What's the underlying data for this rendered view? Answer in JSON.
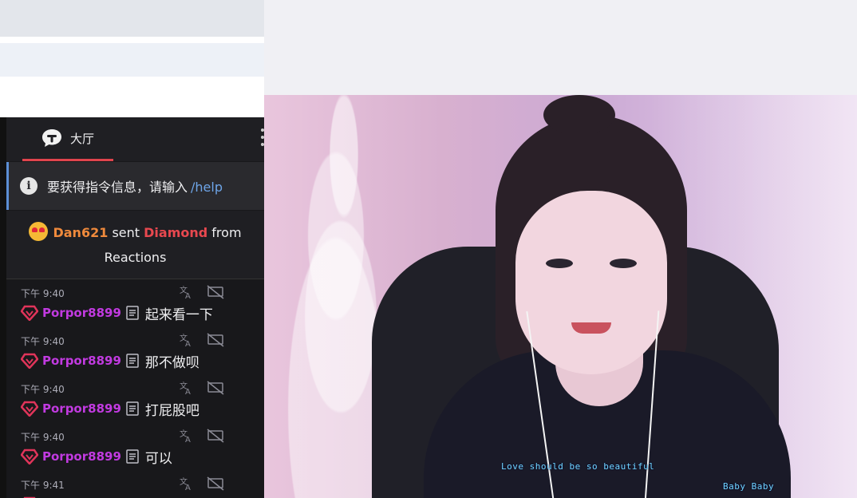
{
  "chat": {
    "tab_label": "大厅",
    "help_notice": {
      "text": "要获得指令信息，请输入",
      "command": "/help"
    },
    "gift_notice": {
      "user": "Dan621",
      "verb": "sent",
      "item": "Diamond",
      "from_word": "from",
      "source": "Reactions"
    },
    "messages": [
      {
        "time": "下午 9:40",
        "user": "Porpor8899",
        "text": "起来看一下"
      },
      {
        "time": "下午 9:40",
        "user": "Porpor8899",
        "text": "那不做呗"
      },
      {
        "time": "下午 9:40",
        "user": "Porpor8899",
        "text": "打屁股吧"
      },
      {
        "time": "下午 9:40",
        "user": "Porpor8899",
        "text": "可以"
      },
      {
        "time": "下午 9:41",
        "user": "",
        "text": ""
      }
    ]
  },
  "video": {
    "caption_1": "Love should be so beautiful",
    "caption_2": "Baby Baby"
  },
  "colors": {
    "chat_bg": "#18181b",
    "tab_underline": "#e0444d",
    "help_command": "#6ea5e8",
    "gift_user": "#f08a3c",
    "gift_item": "#e8484f",
    "username": "#c13ae0",
    "caption": "#6fd6ff"
  },
  "icons": {
    "tab": "chat-bubble-icon",
    "help": "info-icon",
    "gift": "heart-eyes-emoji-icon",
    "translate": "translate-icon",
    "block": "hide-message-icon",
    "badge": "gem-badge-icon",
    "message_type": "document-icon"
  }
}
